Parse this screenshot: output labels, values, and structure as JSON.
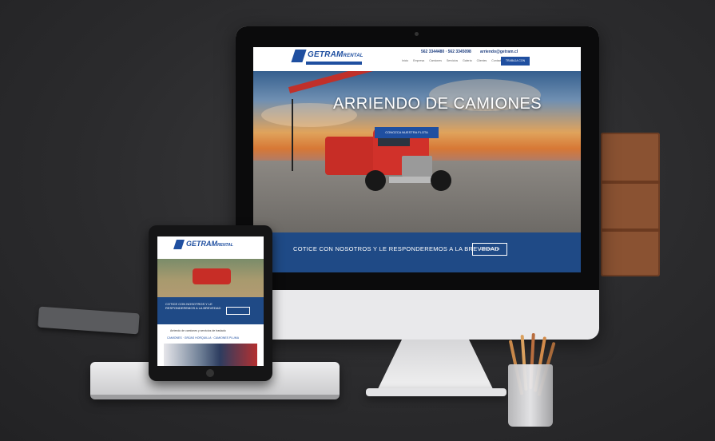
{
  "website": {
    "logo": "GETRAM",
    "logo_suffix": "RENTAL",
    "phone_numbers": "562 3344480 · 562 3345098",
    "email": "arriendo@getram.cl",
    "cta_button": "TRABAJA CON NOSOTROS",
    "nav": [
      "Inicio",
      "Empresa",
      "Camiones",
      "Servicios",
      "Galería",
      "Clientes",
      "Contacto"
    ],
    "hero_title": "ARRIENDO DE CAMIONES",
    "hero_button": "CONOZCA NUESTRA FLOTA",
    "band_text": "COTICE CON NOSOTROS Y LE RESPONDEREMOS A LA BREVEDAD",
    "band_button": "CONTACTO"
  },
  "tablet_site": {
    "logo": "GETRAM",
    "logo_suffix": "RENTAL",
    "band_text": "COTICE CON NOSOTROS Y LE RESPONDEREMOS A LA BREVEDAD",
    "intro_text": "Arriendo de camiones y servicios de traslado",
    "links_text": "CAMIONES · GRÚAS HORQUILLA · CAMIONES PLUMA"
  },
  "colors": {
    "brand_blue": "#1f4fa0",
    "truck_red": "#c72d26",
    "background": "#2b2b2d"
  }
}
